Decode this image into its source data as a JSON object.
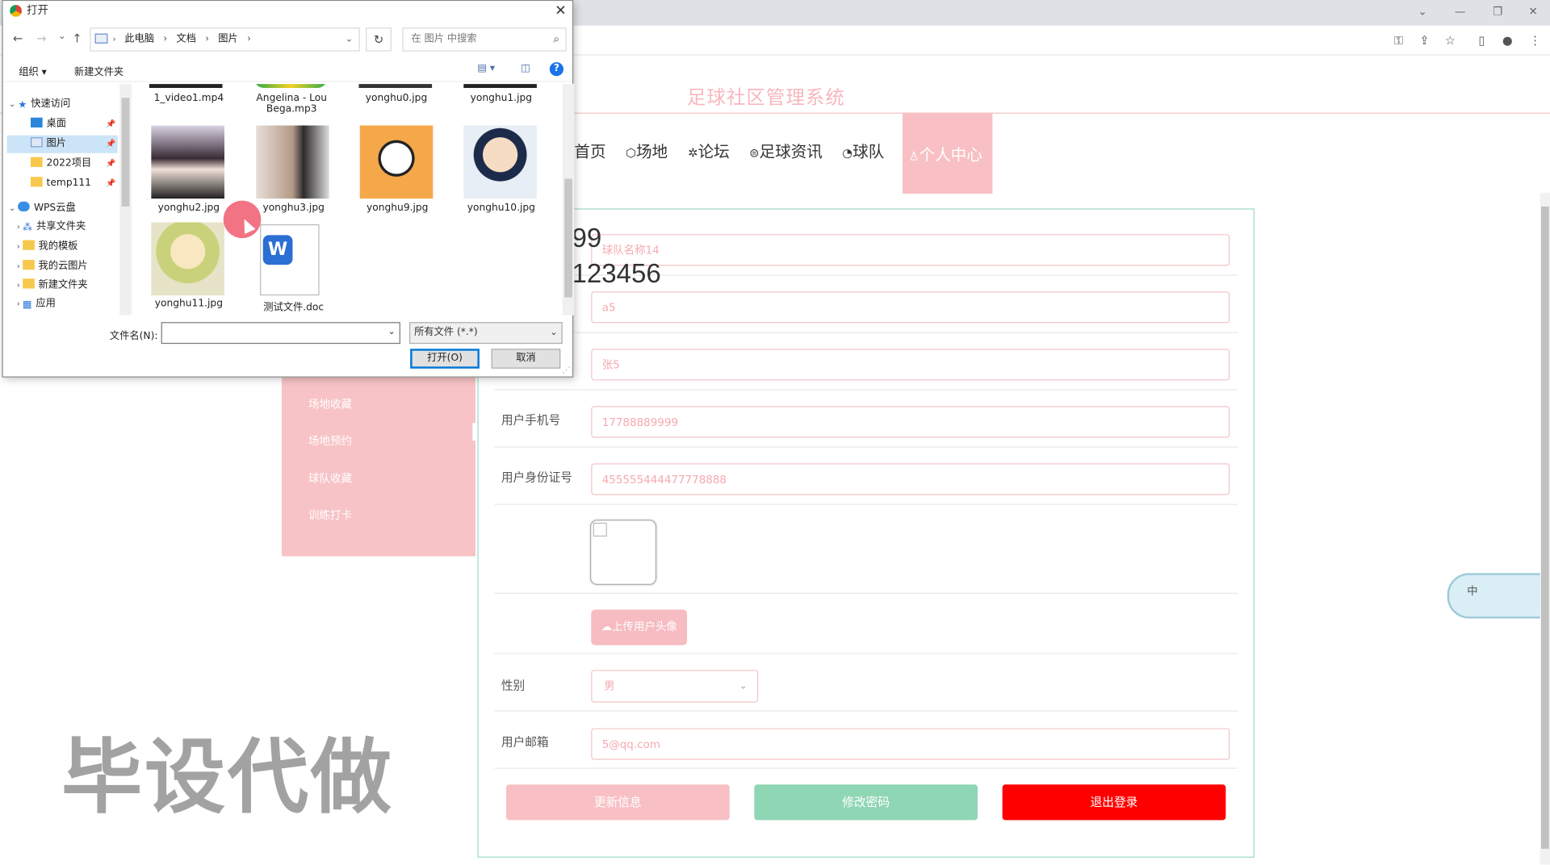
{
  "browser": {
    "window_controls": [
      "⌄",
      "—",
      "❐",
      "✕"
    ],
    "toolbar_icons": [
      "key-icon",
      "share-icon",
      "star-icon",
      "sidebar-icon",
      "profile-icon",
      "menu-icon"
    ]
  },
  "site": {
    "title": "足球社区管理系统",
    "nav": [
      "首页",
      "场地",
      "论坛",
      "足球资讯",
      "球队"
    ],
    "nav_active": "个人中心"
  },
  "sidebar": {
    "items": [
      "场地收藏",
      "场地预约",
      "球队收藏",
      "训练打卡"
    ]
  },
  "form": {
    "team_name_value": "球队名称14",
    "account_value": "a5",
    "name_value": "张5",
    "phone_label": "用户手机号",
    "phone_value": "17788889999",
    "idcard_label": "用户身份证号",
    "idcard_value": "455555444477778888",
    "upload_label": "上传用户头像",
    "gender_label": "性别",
    "gender_value": "男",
    "email_label": "用户邮箱",
    "email_value": "5@qq.com",
    "update_button": "更新信息",
    "password_button": "修改密码",
    "logout_button": "退出登录"
  },
  "colors": {
    "accent_pink": "#f8c0c4",
    "teal_button": "#8fd6b4",
    "logout_red": "#ff0000"
  },
  "watermark": {
    "line1": "git:chenqi199",
    "line2": "v x:chen_q123456",
    "big": "毕设代做"
  },
  "float_widget": {
    "label": "中"
  },
  "dialog": {
    "title": "打开",
    "close": "✕",
    "breadcrumb": [
      "此电脑",
      "文档",
      "图片"
    ],
    "search_placeholder": "在 图片 中搜索",
    "organize": "组织 ▾",
    "new_folder": "新建文件夹",
    "tree": {
      "quick_access": "快速访问",
      "desktop": "桌面",
      "pictures": "图片",
      "project": "2022项目",
      "temp": "temp111",
      "wps": "WPS云盘",
      "shared": "共享文件夹",
      "templates": "我的模板",
      "cloud_pics": "我的云图片",
      "new_folder": "新建文件夹",
      "apps": "应用"
    },
    "files": {
      "f1": "1_video1.mp4",
      "f2": "Angelina - Lou Bega.mp3",
      "f3": "yonghu0.jpg",
      "f4": "yonghu1.jpg",
      "f5": "yonghu2.jpg",
      "f6": "yonghu3.jpg",
      "f7": "yonghu9.jpg",
      "f8": "yonghu10.jpg",
      "f9": "yonghu11.jpg",
      "f10": "测试文件.doc"
    },
    "filename_label": "文件名(N):",
    "filename_value": "",
    "filetype_value": "所有文件 (*.*)",
    "open_button": "打开(O)",
    "cancel_button": "取消"
  }
}
